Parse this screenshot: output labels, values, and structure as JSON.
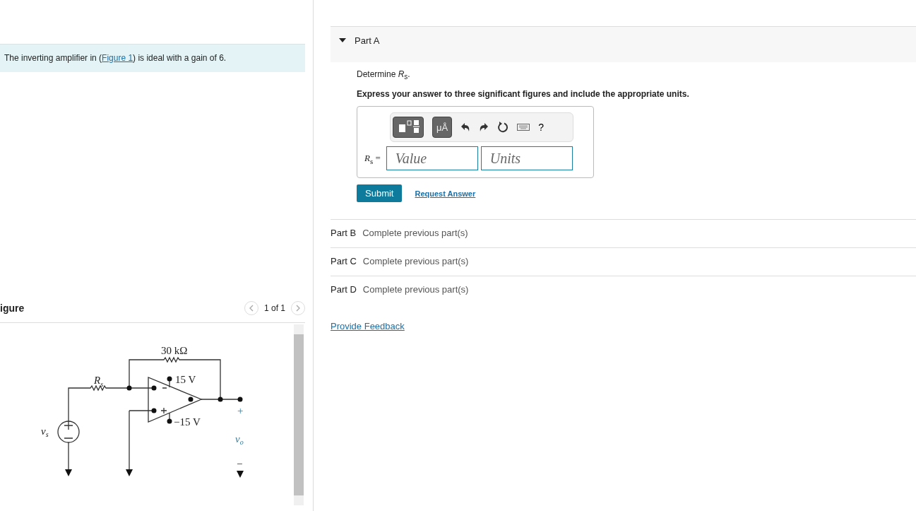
{
  "intro": {
    "before": "The inverting amplifier in (",
    "link": "Figure 1",
    "after": ") is ideal with a gain of 6."
  },
  "figure": {
    "title": "igure",
    "pager": "1 of 1",
    "labels": {
      "feedback_resistor": "30 kΩ",
      "source_resistor": {
        "symbol": "R",
        "subscript": "s"
      },
      "pos_supply": "15 V",
      "neg_supply": "−15 V",
      "source": {
        "symbol": "v",
        "subscript": "s"
      },
      "output": {
        "symbol": "v",
        "subscript": "o"
      },
      "plus": "+",
      "minus": "−"
    }
  },
  "parts": [
    {
      "label": "Part A",
      "expanded": true,
      "prompt": "Determine *R*$_{s}$.",
      "instruction": "Express your answer to three significant figures and include the appropriate units.",
      "units_button": "μÅ",
      "help": "?",
      "answer_label": "*R*$_{s}$ =",
      "value_placeholder": "Value",
      "units_placeholder": "Units",
      "submit": "Submit",
      "request": "Request Answer"
    },
    {
      "label": "Part B",
      "expanded": false,
      "status": "Complete previous part(s)"
    },
    {
      "label": "Part C",
      "expanded": false,
      "status": "Complete previous part(s)"
    },
    {
      "label": "Part D",
      "expanded": false,
      "status": "Complete previous part(s)"
    }
  ],
  "feedback_link": "Provide Feedback"
}
